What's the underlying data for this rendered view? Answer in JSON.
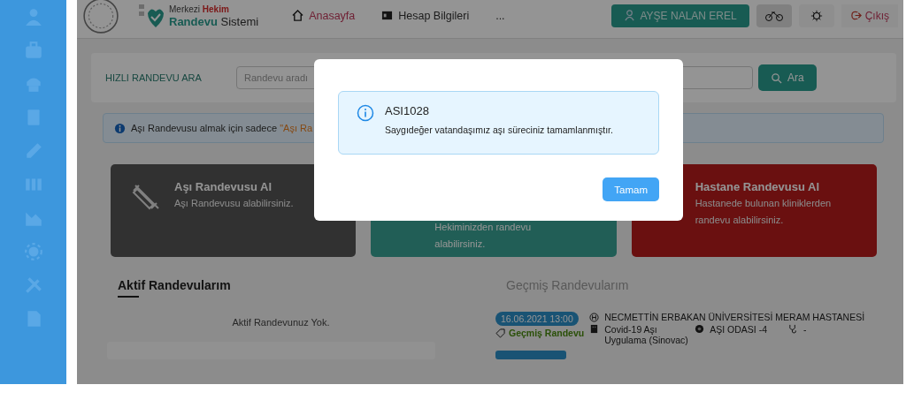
{
  "logo": {
    "line1_a": "Merkezi",
    "line1_b": "Hekim",
    "line2_a": "Randevu",
    "line2_b": "Sistemi"
  },
  "nav": [
    {
      "label": "Anasayfa",
      "kind": "home",
      "selected": true
    },
    {
      "label": "Hesap Bilgileri",
      "kind": "account",
      "selected": false
    },
    {
      "label": "...",
      "kind": "more",
      "selected": false
    }
  ],
  "user_button": "AYŞE NALAN EREL",
  "logout": "Çıkış",
  "search": {
    "label": "HIZLI RANDEVU ARA",
    "placeholder": "Randevu aradı",
    "button": "Ara"
  },
  "notice": {
    "text": "Aşı Randevusu almak için sadece ",
    "highlight": "\"Aşı Ra"
  },
  "cards": [
    {
      "kind": "vaccine",
      "title": "Aşı Randevusu Al",
      "desc": "Aşı Randevusu alabilirsiniz."
    },
    {
      "kind": "doctor",
      "desc": "Hekiminizden randevu alabilirsiniz."
    },
    {
      "kind": "hospital",
      "title": "Hastane Randevusu Al",
      "desc": "Hastanede bulunan kliniklerden randevu alabilirsiniz."
    }
  ],
  "tabs": [
    {
      "label": "Aktif Randevularım",
      "selected": true
    },
    {
      "label": "Geçmiş Randevularım",
      "selected": false
    }
  ],
  "active_empty": "Aktif Randevunuz Yok.",
  "past": {
    "date": "16.06.2021 13:00",
    "status": "Geçmiş Randevu",
    "hospital": "NECMETTİN ERBAKAN ÜNİVERSİTESİ MERAM HASTANESİ",
    "clinic": "Covid-19 Aşı Uygulama (Sinovac)",
    "room": "AŞI ODASI -4",
    "doctor": "-"
  },
  "dialog": {
    "code": "ASI1028",
    "message": "Saygıdeğer vatandaşımız aşı süreciniz tamamlanmıştır.",
    "button": "Tamam"
  }
}
